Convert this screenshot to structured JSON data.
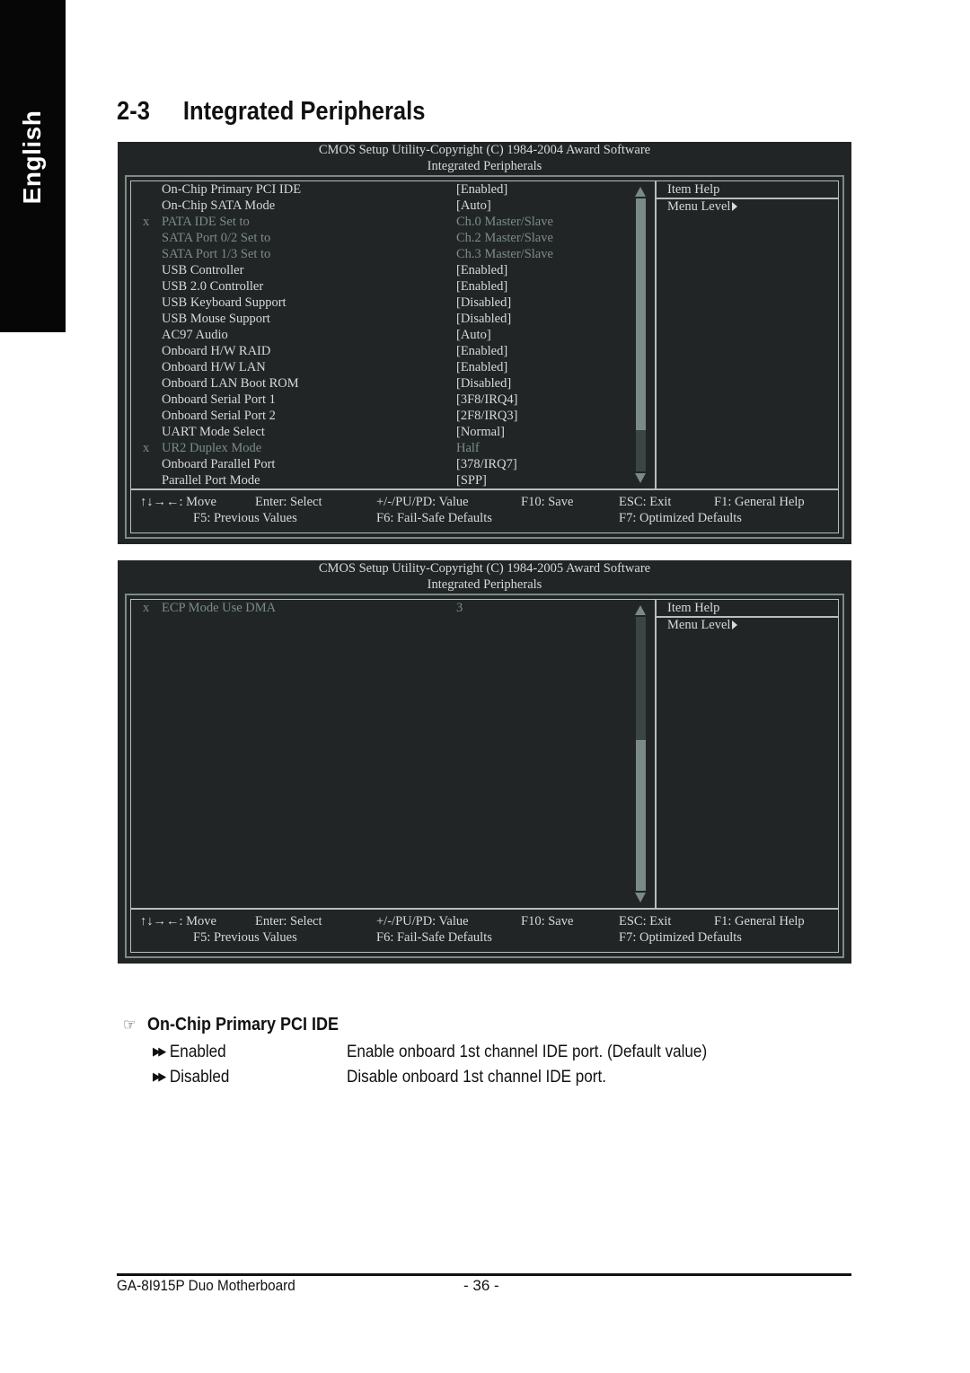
{
  "side_tab": {
    "label": "English"
  },
  "section": {
    "number": "2-3",
    "title": "Integrated Peripherals"
  },
  "bios_screens": [
    {
      "header_line1": "CMOS Setup Utility-Copyright (C) 1984-2004 Award Software",
      "header_line2": "Integrated Peripherals",
      "items": [
        {
          "mark": "",
          "label": "On-Chip Primary PCI IDE",
          "value": "[Enabled]",
          "dimmed": false
        },
        {
          "mark": "",
          "label": "On-Chip SATA Mode",
          "value": "[Auto]",
          "dimmed": false
        },
        {
          "mark": "x",
          "label": "PATA IDE Set to",
          "value": "Ch.0 Master/Slave",
          "dimmed": true
        },
        {
          "mark": "",
          "label": "SATA Port 0/2 Set to",
          "value": "Ch.2 Master/Slave",
          "dimmed": true
        },
        {
          "mark": "",
          "label": "SATA Port 1/3 Set to",
          "value": "Ch.3 Master/Slave",
          "dimmed": true
        },
        {
          "mark": "",
          "label": "USB Controller",
          "value": "[Enabled]",
          "dimmed": false
        },
        {
          "mark": "",
          "label": "USB 2.0 Controller",
          "value": "[Enabled]",
          "dimmed": false
        },
        {
          "mark": "",
          "label": "USB Keyboard Support",
          "value": "[Disabled]",
          "dimmed": false
        },
        {
          "mark": "",
          "label": "USB Mouse Support",
          "value": "[Disabled]",
          "dimmed": false
        },
        {
          "mark": "",
          "label": "AC97 Audio",
          "value": "[Auto]",
          "dimmed": false
        },
        {
          "mark": "",
          "label": "Onboard H/W RAID",
          "value": "[Enabled]",
          "dimmed": false
        },
        {
          "mark": "",
          "label": "Onboard H/W LAN",
          "value": "[Enabled]",
          "dimmed": false
        },
        {
          "mark": "",
          "label": "Onboard LAN Boot ROM",
          "value": "[Disabled]",
          "dimmed": false
        },
        {
          "mark": "",
          "label": "Onboard Serial Port 1",
          "value": "[3F8/IRQ4]",
          "dimmed": false
        },
        {
          "mark": "",
          "label": "Onboard Serial Port 2",
          "value": "[2F8/IRQ3]",
          "dimmed": false
        },
        {
          "mark": "",
          "label": "UART Mode Select",
          "value": "[Normal]",
          "dimmed": false
        },
        {
          "mark": "x",
          "label": "UR2 Duplex Mode",
          "value": "Half",
          "dimmed": true
        },
        {
          "mark": "",
          "label": "Onboard Parallel Port",
          "value": "[378/IRQ7]",
          "dimmed": false
        },
        {
          "mark": "",
          "label": "Parallel Port Mode",
          "value": "[SPP]",
          "dimmed": false
        }
      ],
      "scroll": {
        "thumb_start": 0.0,
        "thumb_end": 0.85
      },
      "help": {
        "title": "Item Help",
        "menu_level": "Menu Level"
      },
      "keys": {
        "move": "↑↓→←: Move",
        "enter": "Enter: Select",
        "value": "+/-/PU/PD: Value",
        "save": "F10: Save",
        "exit": "ESC: Exit",
        "help": "F1: General Help",
        "previous": "F5: Previous Values",
        "failsafe": "F6: Fail-Safe Defaults",
        "optimized": "F7: Optimized Defaults"
      }
    },
    {
      "header_line1": "CMOS Setup Utility-Copyright (C) 1984-2005 Award Software",
      "header_line2": "Integrated Peripherals",
      "items": [
        {
          "mark": "x",
          "label": "ECP Mode Use DMA",
          "value": "3",
          "dimmed": true
        }
      ],
      "scroll": {
        "thumb_start": 0.45,
        "thumb_end": 1.0
      },
      "help": {
        "title": "Item Help",
        "menu_level": "Menu Level"
      },
      "keys": {
        "move": "↑↓→←: Move",
        "enter": "Enter: Select",
        "value": "+/-/PU/PD: Value",
        "save": "F10: Save",
        "exit": "ESC: Exit",
        "help": "F1: General Help",
        "previous": "F5: Previous Values",
        "failsafe": "F6: Fail-Safe Defaults",
        "optimized": "F7: Optimized Defaults"
      }
    }
  ],
  "description": {
    "icon": "pointing-hand-icon",
    "title": "On-Chip Primary PCI IDE",
    "bullet_icon": "double-arrow-icon",
    "options": [
      {
        "name": "Enabled",
        "text": "Enable onboard 1st channel IDE port. (Default value)"
      },
      {
        "name": "Disabled",
        "text": "Disable onboard 1st channel IDE port."
      }
    ]
  },
  "footer": {
    "model": "GA-8I915P Duo Motherboard",
    "page": "- 36 -"
  }
}
